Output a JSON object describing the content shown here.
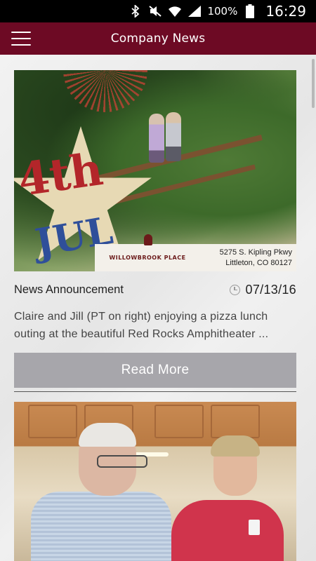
{
  "status_bar": {
    "icons": [
      "bluetooth-icon",
      "mute-icon",
      "wifi-icon",
      "signal-icon",
      "battery-icon"
    ],
    "battery": "100%",
    "time": "16:29"
  },
  "app_bar": {
    "title": "Company News",
    "menu_icon": "hamburger-menu-icon",
    "color": "#6d0a24"
  },
  "posts": [
    {
      "image_caption": {
        "brand": "WILLOWBROOK PLACE",
        "address_line1": "5275 S. Kipling Pkwy",
        "address_line2": "Littleton, CO 80127",
        "banner_a": "4th",
        "banner_b": "JUL"
      },
      "category": "News Announcement",
      "date": "07/13/16",
      "summary": "Claire and Jill (PT on right) enjoying a pizza lunch\nouting at the beautiful Red Rocks Amphitheater ...",
      "read_more_label": "Read More"
    },
    {}
  ],
  "colors": {
    "button": "#a7a6ab",
    "divider": "#555555"
  }
}
